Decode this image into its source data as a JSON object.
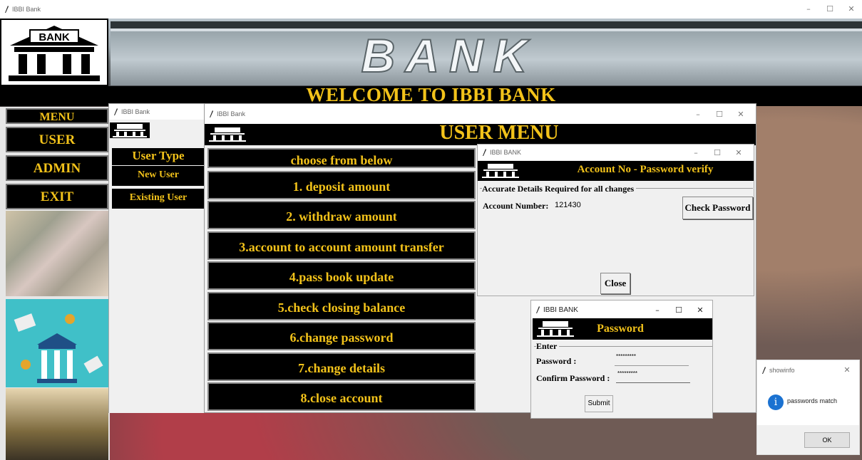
{
  "main_window": {
    "title": "IBBI Bank",
    "sign_text": "BANK",
    "logo_text": "BANK",
    "welcome": "WELCOME TO IBBI BANK"
  },
  "menu": {
    "heading": "MENU",
    "items": [
      {
        "label": "USER"
      },
      {
        "label": "ADMIN"
      },
      {
        "label": "EXIT"
      }
    ]
  },
  "user_type_window": {
    "title": "IBBI Bank",
    "heading": "User Type",
    "items": [
      {
        "label": "New User"
      },
      {
        "label": "Existing User"
      }
    ]
  },
  "user_menu_window": {
    "title": "IBBI Bank",
    "heading": "USER MENU",
    "prompt": "choose from below",
    "options": [
      {
        "label": "1. deposit amount"
      },
      {
        "label": "2. withdraw amount"
      },
      {
        "label": "3.account to account amount transfer"
      },
      {
        "label": "4.pass book update"
      },
      {
        "label": "5.check closing balance"
      },
      {
        "label": "6.change password"
      },
      {
        "label": "7.change details"
      },
      {
        "label": "8.close account"
      }
    ]
  },
  "account_verify_window": {
    "title": "IBBI BANK",
    "heading": "Account No - Password verify",
    "frame_label": "Accurate Details Required for all changes",
    "account_label": "Account Number:",
    "account_value": "121430",
    "check_button": "Check Password",
    "close_button": "Close"
  },
  "password_window": {
    "title": "IBBI BANK",
    "heading": "Password",
    "frame_label": "Enter",
    "password_label": "Password :",
    "password_value": "*********",
    "confirm_label": "Confirm Password :",
    "confirm_value": "*********",
    "submit_button": "Submit"
  },
  "showinfo_dialog": {
    "title": "showinfo",
    "message": "passwords  match",
    "ok_button": "OK"
  },
  "colors": {
    "accent_gold": "#f2c21a",
    "panel_black": "#000000",
    "info_blue": "#1b72d1"
  }
}
